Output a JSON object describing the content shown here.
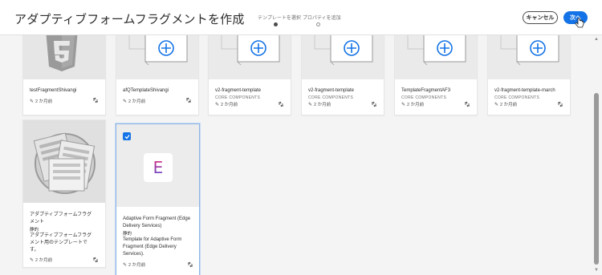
{
  "header": {
    "title": "アダプティブフォームフラグメントを作成",
    "steps": [
      {
        "label": "テンプレートを選択"
      },
      {
        "label": "プロパティを追加"
      }
    ],
    "cancel_label": "キャンセル",
    "next_label": "次へ"
  },
  "cards_top": [
    {
      "title": "testFragmentShivangi",
      "sub": "",
      "date": "2 か月前",
      "thumb": "html5-icon"
    },
    {
      "title": "afQTemplateShivangi",
      "sub": "",
      "date": "2 か月前",
      "thumb": "add-icon"
    },
    {
      "title": "v2-fragment-template",
      "sub": "CORE COMPONENTS",
      "date": "2 か月前",
      "thumb": "add-icon"
    },
    {
      "title": "v2-fragment-template",
      "sub": "CORE COMPONENTS",
      "date": "2 か月前",
      "thumb": "add-icon"
    },
    {
      "title": "TemplateFragmentAF3",
      "sub": "CORE COMPONENTS",
      "date": "2 か月前",
      "thumb": "add-icon"
    },
    {
      "title": "v2-fragment-template-march",
      "sub": "CORE COMPONENTS",
      "date": "2 か月前",
      "thumb": "add-icon"
    }
  ],
  "card_af": {
    "title_line1": "アダプティブフォームフラグ",
    "title_line2": "メント",
    "status": "静的",
    "desc_line1": "アダプティブフォームフラグ",
    "desc_line2": "メント用のテンプレートで",
    "desc_line3": "す。",
    "date": "2 か月前"
  },
  "card_eds": {
    "title_line1": "Adaptive Form Fragment (Edge",
    "title_line2": "Delivery Services)",
    "status": "静的",
    "desc_line1": "Template for Adaptive Form",
    "desc_line2": "Fragment (Edge Delivery",
    "desc_line3": "Services).",
    "date": "2 か月前",
    "logo_letter": "E"
  },
  "colors": {
    "accent": "#1473e6",
    "add_icon": "#1473e6",
    "thumb_bg": "#eaeaea"
  }
}
